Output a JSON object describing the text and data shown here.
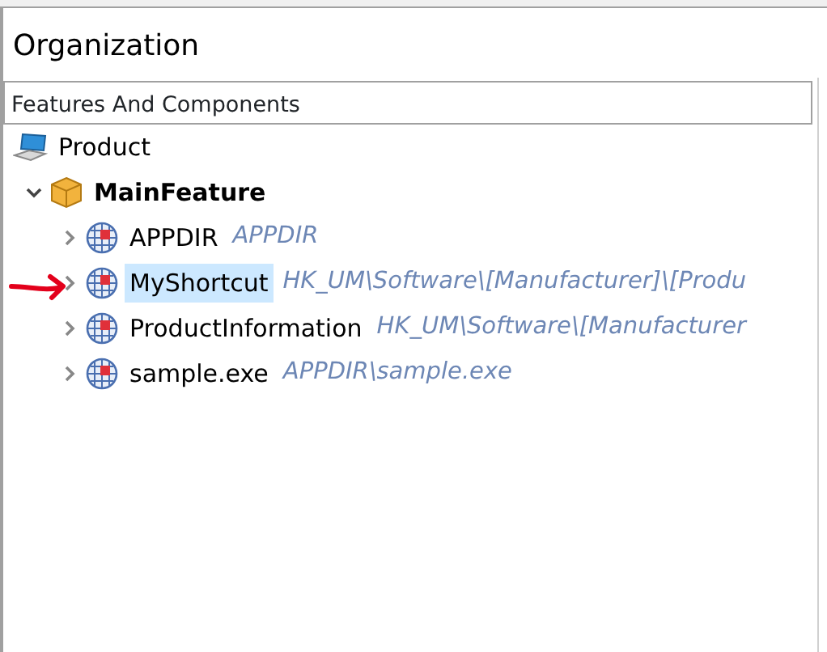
{
  "panel": {
    "title": "Organization"
  },
  "tree": {
    "header": "Features And Components",
    "items": [
      {
        "label": "Product",
        "kind": "product",
        "children": [
          {
            "label": "MainFeature",
            "kind": "feature",
            "expanded": true,
            "children": [
              {
                "label": "APPDIR",
                "detail": "APPDIR",
                "kind": "component",
                "expanded": false,
                "selected": false
              },
              {
                "label": "MyShortcut",
                "detail": "HK_UM\\Software\\[Manufacturer]\\[Produ",
                "kind": "component",
                "expanded": false,
                "selected": true
              },
              {
                "label": "ProductInformation",
                "detail": "HK_UM\\Software\\[Manufacturer",
                "kind": "component",
                "expanded": false,
                "selected": false
              },
              {
                "label": "sample.exe",
                "detail": "APPDIR\\sample.exe",
                "kind": "component",
                "expanded": false,
                "selected": false
              }
            ]
          }
        ]
      }
    ]
  }
}
